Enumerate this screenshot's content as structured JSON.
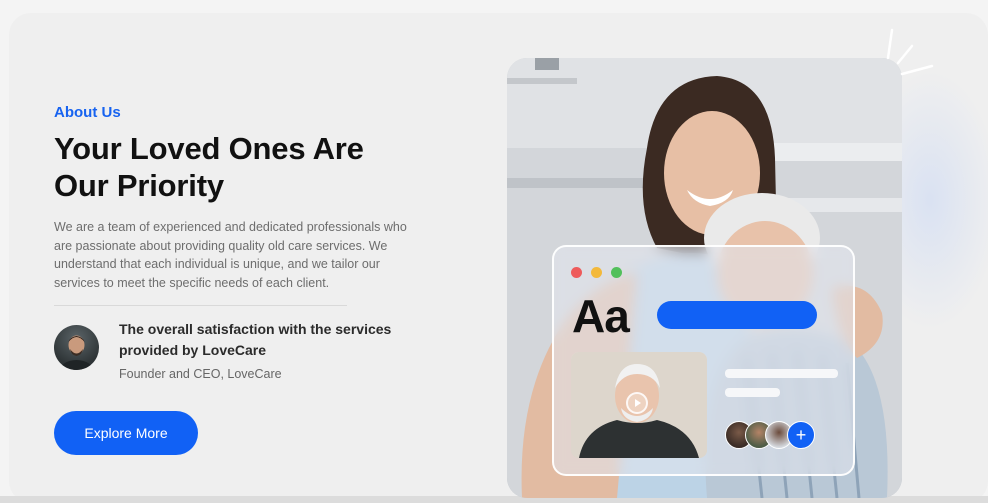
{
  "about": {
    "eyebrow": "About Us",
    "title": "Your Loved Ones Are Our Priority",
    "description": "We are a team of experienced and dedicated professionals who are passionate about providing quality old care services. We understand that each individual is unique, and we tailor our services to meet the specific needs of each client.",
    "testimonial": {
      "quote": "The overall satisfaction with the services provided by LoveCare",
      "role": "Founder and CEO, LoveCare"
    },
    "cta_label": "Explore More"
  },
  "overlay": {
    "font_sample": "Aa",
    "add_symbol": "+",
    "window_dots": [
      "#ee5b5b",
      "#f3b93b",
      "#52c05b"
    ],
    "accent": "#1161f5"
  },
  "colors": {
    "brand_blue": "#1161f5",
    "eyebrow_blue": "#1763f0",
    "heading": "#111111",
    "body_text": "#6d6d6d"
  }
}
